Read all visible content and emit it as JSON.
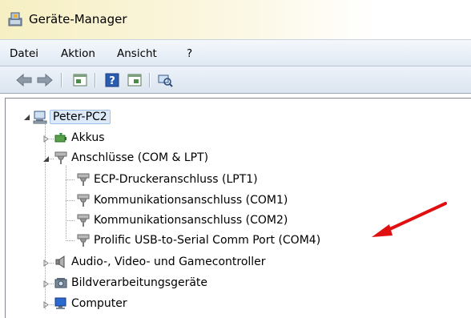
{
  "window": {
    "title": "Geräte-Manager"
  },
  "menu": [
    "Datei",
    "Aktion",
    "Ansicht",
    "?"
  ],
  "toolbar": [
    "back-icon",
    "forward-icon",
    "properties-icon",
    "help-icon",
    "view-icon",
    "scan-hardware-icon"
  ],
  "tree": {
    "root": "Peter-PC2",
    "items": [
      {
        "label": "Akkus",
        "icon": "battery-icon",
        "expanded": false
      },
      {
        "label": "Anschlüsse (COM & LPT)",
        "icon": "port-icon",
        "expanded": true,
        "children": [
          "ECP-Druckeranschluss (LPT1)",
          "Kommunikationsanschluss (COM1)",
          "Kommunikationsanschluss (COM2)",
          "Prolific USB-to-Serial Comm Port (COM4)"
        ]
      },
      {
        "label": "Audio-, Video- und Gamecontroller",
        "icon": "speaker-icon",
        "expanded": false
      },
      {
        "label": "Bildverarbeitungsgeräte",
        "icon": "camera-icon",
        "expanded": false
      },
      {
        "label": "Computer",
        "icon": "computer-icon",
        "expanded": false
      }
    ]
  },
  "annotation": {
    "arrow_color": "#e01010"
  }
}
